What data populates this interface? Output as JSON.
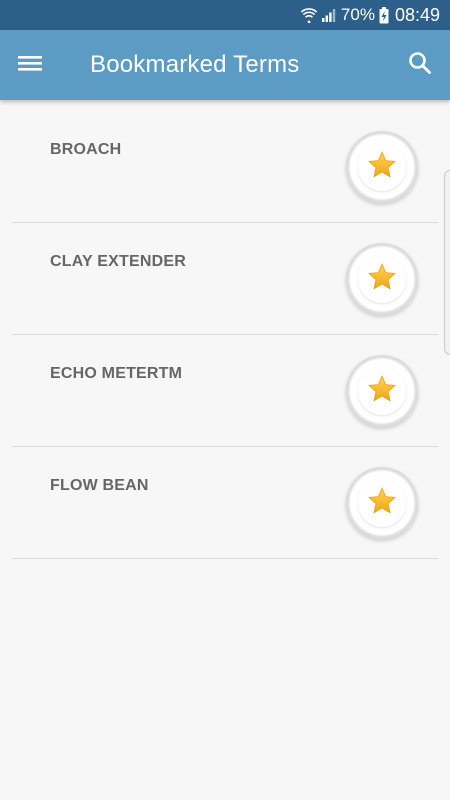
{
  "status_bar": {
    "battery_percent": "70%",
    "time": "08:49",
    "icons": [
      "wifi-icon",
      "signal-icon",
      "battery-charging-icon"
    ]
  },
  "app_bar": {
    "title": "Bookmarked Terms",
    "menu_icon": "hamburger-menu-icon",
    "search_icon": "search-icon",
    "background_color": "#5b9bc4"
  },
  "terms": [
    {
      "label": "BROACH",
      "bookmark_icon": "star-icon",
      "bookmarked": true
    },
    {
      "label": "CLAY EXTENDER",
      "bookmark_icon": "star-icon",
      "bookmarked": true
    },
    {
      "label": "ECHO METERTM",
      "bookmark_icon": "star-icon",
      "bookmarked": true
    },
    {
      "label": "FLOW BEAN",
      "bookmark_icon": "star-icon",
      "bookmarked": true
    }
  ],
  "colors": {
    "status_bar": "#2c5f8a",
    "star": "#f6b82a",
    "term_text": "#666666",
    "background": "#f7f7f7"
  }
}
